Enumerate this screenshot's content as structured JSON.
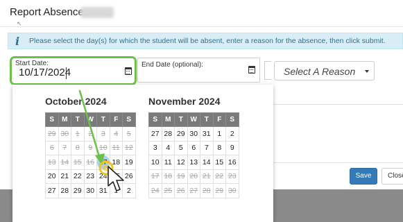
{
  "dialog": {
    "title": "Report Absences -",
    "info_text": "Please select the day(s) for which the student will be absent, enter a reason for the absence, then click submit.",
    "info_icon": "i"
  },
  "form": {
    "start_label": "Start Date:",
    "start_value": "10/17/2024",
    "end_label": "End Date (optional):",
    "reason_placeholder": "Select A Reason"
  },
  "buttons": {
    "save": "Save",
    "close": "Close"
  },
  "calendar": {
    "weekdays": [
      "S",
      "M",
      "T",
      "W",
      "T",
      "F",
      "S"
    ],
    "months": [
      {
        "title": "October 2024",
        "weeks": [
          [
            {
              "d": "29",
              "dis": true
            },
            {
              "d": "30",
              "dis": true
            },
            {
              "d": "1",
              "dis": true
            },
            {
              "d": "2",
              "dis": true
            },
            {
              "d": "3",
              "dis": true
            },
            {
              "d": "4",
              "dis": true
            },
            {
              "d": "5",
              "dis": true
            }
          ],
          [
            {
              "d": "6",
              "dis": true
            },
            {
              "d": "7",
              "dis": true
            },
            {
              "d": "8",
              "dis": true
            },
            {
              "d": "9",
              "dis": true
            },
            {
              "d": "10",
              "dis": true
            },
            {
              "d": "11",
              "dis": true
            },
            {
              "d": "12",
              "dis": true
            }
          ],
          [
            {
              "d": "13",
              "dis": true
            },
            {
              "d": "14",
              "dis": true
            },
            {
              "d": "15",
              "dis": true
            },
            {
              "d": "16",
              "dis": true
            },
            {
              "d": "17",
              "sel": true
            },
            {
              "d": "18"
            },
            {
              "d": "19"
            }
          ],
          [
            {
              "d": "20"
            },
            {
              "d": "21"
            },
            {
              "d": "22"
            },
            {
              "d": "23"
            },
            {
              "d": "24"
            },
            {
              "d": "25"
            },
            {
              "d": "26"
            }
          ],
          [
            {
              "d": "27"
            },
            {
              "d": "28"
            },
            {
              "d": "29"
            },
            {
              "d": "30"
            },
            {
              "d": "31"
            },
            {
              "d": "1"
            },
            {
              "d": "2"
            }
          ]
        ]
      },
      {
        "title": "November 2024",
        "weeks": [
          [
            {
              "d": "27"
            },
            {
              "d": "28"
            },
            {
              "d": "29"
            },
            {
              "d": "30"
            },
            {
              "d": "31"
            },
            {
              "d": "1"
            },
            {
              "d": "2"
            }
          ],
          [
            {
              "d": "3"
            },
            {
              "d": "4"
            },
            {
              "d": "5"
            },
            {
              "d": "6"
            },
            {
              "d": "7"
            },
            {
              "d": "8"
            },
            {
              "d": "9"
            }
          ],
          [
            {
              "d": "10"
            },
            {
              "d": "11"
            },
            {
              "d": "12"
            },
            {
              "d": "13"
            },
            {
              "d": "14"
            },
            {
              "d": "15"
            },
            {
              "d": "16"
            }
          ],
          [
            {
              "d": "17",
              "dis": true
            },
            {
              "d": "18",
              "dis": true
            },
            {
              "d": "19",
              "dis": true
            },
            {
              "d": "20",
              "dis": true
            },
            {
              "d": "21",
              "dis": true
            },
            {
              "d": "22",
              "dis": true
            },
            {
              "d": "23",
              "dis": true
            }
          ],
          [
            {
              "d": "24",
              "dis": true
            },
            {
              "d": "25",
              "dis": true
            },
            {
              "d": "26",
              "dis": true
            },
            {
              "d": "27",
              "dis": true
            },
            {
              "d": "28",
              "dis": true
            },
            {
              "d": "29",
              "dis": true
            },
            {
              "d": "30",
              "dis": true
            }
          ]
        ]
      }
    ]
  },
  "colors": {
    "highlight": "#6cc04a",
    "selected_day": "#a9d3ea",
    "primary_button": "#337ab7",
    "info_bg": "#d9edf7"
  },
  "icons": {
    "info": "info-icon",
    "calendar": "calendar-icon",
    "dropdown": "caret-down-icon",
    "pointer": "hand-pointer-icon",
    "annotation": "green-arrow"
  }
}
